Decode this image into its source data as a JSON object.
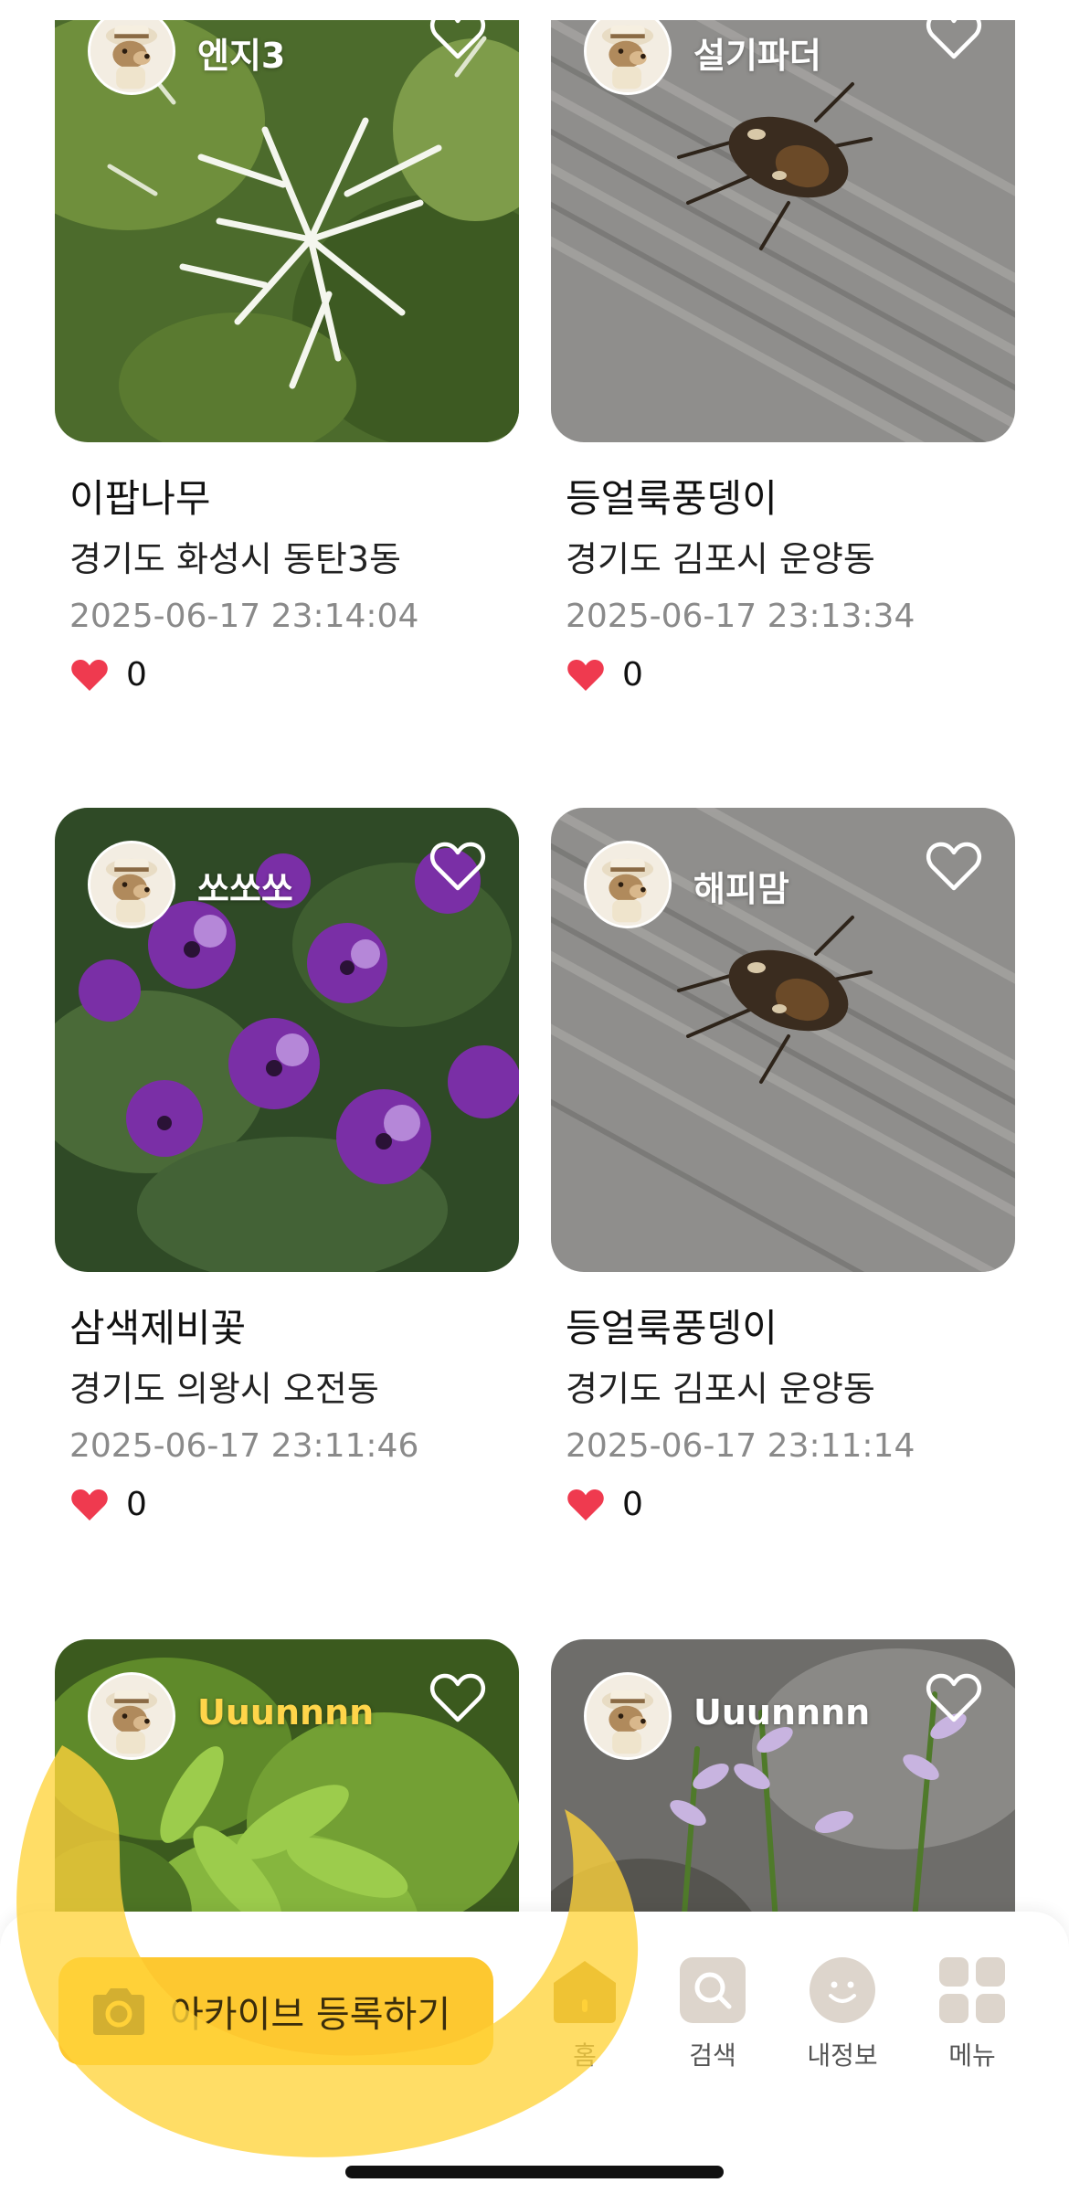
{
  "feed": {
    "cards": [
      {
        "username": "엔지3",
        "species": "이팝나무",
        "location": "경기도 화성시 동탄3동",
        "date": "2025-06-17 23:14:04",
        "likes": "0",
        "photo": "white-flower-tree"
      },
      {
        "username": "설기파더",
        "species": "등얼룩풍뎅이",
        "location": "경기도 김포시 운양동",
        "date": "2025-06-17 23:13:34",
        "likes": "0",
        "photo": "beetle-on-wood"
      },
      {
        "username": "쏘쏘쏘",
        "species": "삼색제비꽃",
        "location": "경기도 의왕시 오전동",
        "date": "2025-06-17 23:11:46",
        "likes": "0",
        "photo": "purple-pansies"
      },
      {
        "username": "해피맘",
        "species": "등얼룩풍뎅이",
        "location": "경기도 김포시 운양동",
        "date": "2025-06-17 23:11:14",
        "likes": "0",
        "photo": "beetle-on-wood"
      },
      {
        "username": "Uuunnnn",
        "photo": "green-leaves"
      },
      {
        "username": "Uuunnnn",
        "photo": "hosta-flowers"
      }
    ]
  },
  "bottom_bar": {
    "register_label": "아카이브 등록하기",
    "register_icon": "camera-icon",
    "nav": [
      {
        "label": "홈",
        "icon": "home-icon",
        "active": true
      },
      {
        "label": "검색",
        "icon": "search-icon",
        "active": false
      },
      {
        "label": "내정보",
        "icon": "profile-icon",
        "active": false
      },
      {
        "label": "메뉴",
        "icon": "menu-grid-icon",
        "active": false
      }
    ]
  },
  "colors": {
    "accent_yellow": "#fdc830",
    "like_red": "#ef3a4f",
    "home_active": "#b68a1d",
    "nav_inactive": "#ddd5cc"
  }
}
